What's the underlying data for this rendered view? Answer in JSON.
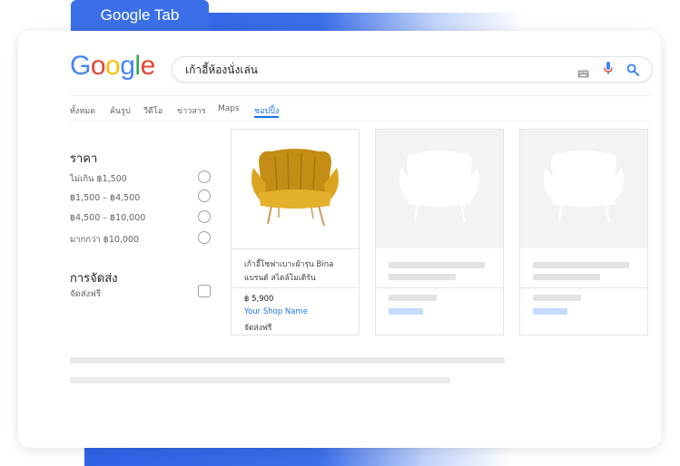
{
  "tab": {
    "label": "Google Tab"
  },
  "logo": {
    "letters": [
      "G",
      "o",
      "o",
      "g",
      "l",
      "e"
    ],
    "colors": [
      "#4285F4",
      "#EA4335",
      "#FBBC05",
      "#4285F4",
      "#34A853",
      "#EA4335"
    ]
  },
  "search": {
    "query": "เก้าอี้ห้องนั่งเล่น"
  },
  "nav": {
    "items": [
      "ทั้งหมด",
      "ค้นรูป",
      "วีดีโอ",
      "ข่าวสาร",
      "Maps",
      "ชอปปิ้ง"
    ],
    "active": "ชอปปิ้ง"
  },
  "filters": {
    "price_title": "ราคา",
    "price_options": [
      "ไม่เกิน ฿1,500",
      "฿1,500 – ฿4,500",
      "฿4,500 – ฿10,000",
      "มากกว่า ฿10,000"
    ],
    "shipping_title": "การจัดส่ง",
    "shipping_option": "จัดส่งฟรี"
  },
  "product": {
    "title": "เก้าอี้โซฟาเบาะผ้ารุ่น Bina แบรนด์ สไตล์โมเดิร์น",
    "price": "฿ 5,900",
    "shop": "Your Shop Name",
    "shipping": "จัดส่งฟรี"
  },
  "colors": {
    "accent": "#3b6fe8",
    "link": "#1a73e8",
    "chair": "#d9a521"
  }
}
